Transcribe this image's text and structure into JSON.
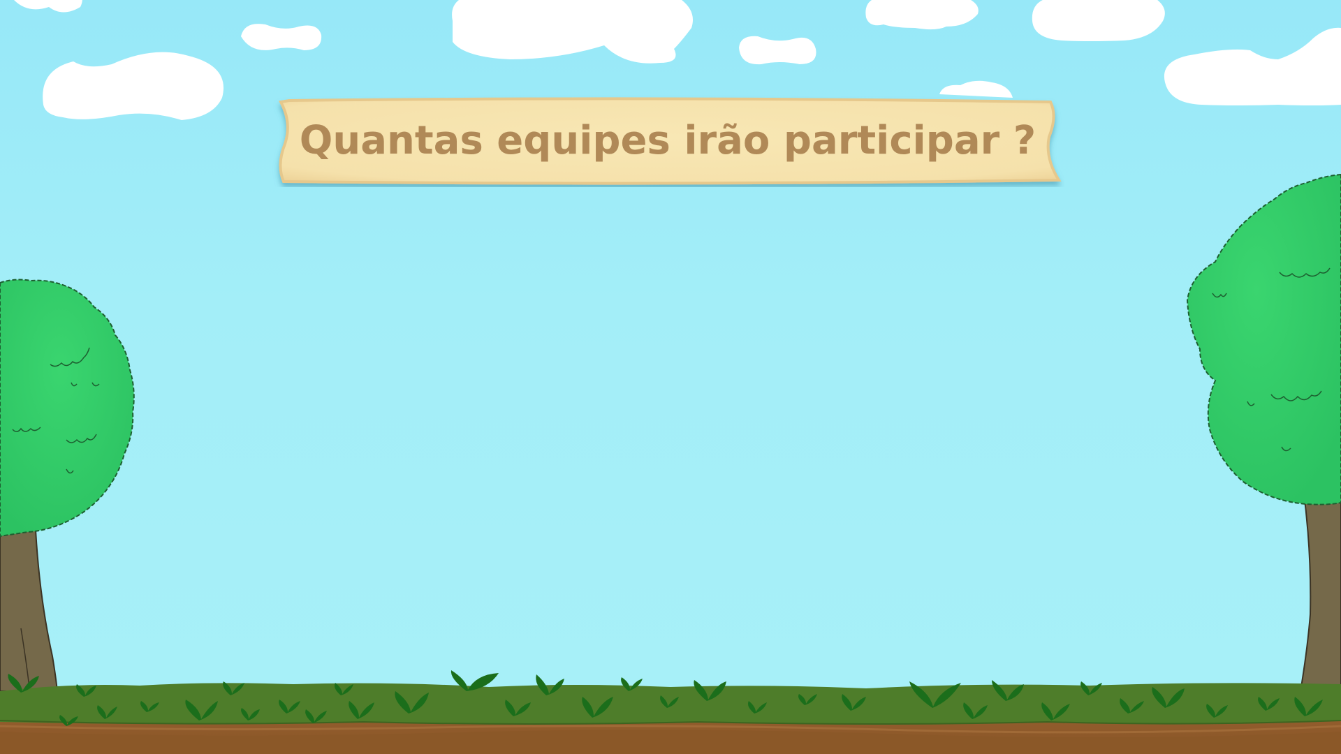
{
  "scene": {
    "question": "Quantas equipes irão participar ?"
  },
  "colors": {
    "sky": "#a3eef8",
    "cloud": "#ffffff",
    "banner_fill": "#f6e3ad",
    "banner_border": "#e0c48a",
    "banner_text": "#b08957",
    "tree_foliage": "#33cc66",
    "tree_trunk": "#75694a",
    "grass": "#4e7d2a",
    "sprout": "#1b6e1b",
    "soil": "#8f5a2c"
  },
  "icons": {
    "cloud": "cloud-icon",
    "tree": "tree-icon",
    "sprout": "sprout-icon"
  }
}
